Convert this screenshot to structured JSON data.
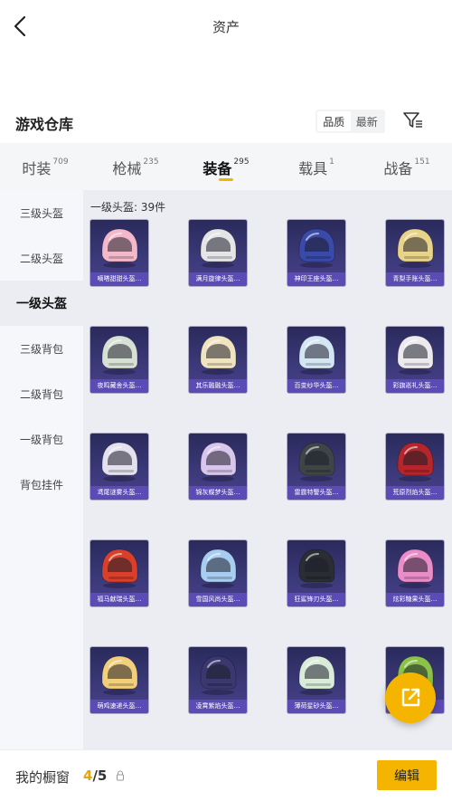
{
  "header": {
    "title": "资产"
  },
  "section": {
    "title": "游戏仓库",
    "sort_options": [
      "品质",
      "最新"
    ],
    "active_sort": 0
  },
  "tabs": [
    {
      "label": "时装",
      "count": "709"
    },
    {
      "label": "枪械",
      "count": "235"
    },
    {
      "label": "装备",
      "count": "295",
      "active": true
    },
    {
      "label": "载具",
      "count": "1"
    },
    {
      "label": "战备",
      "count": "151"
    }
  ],
  "sidebar": {
    "items": [
      {
        "label": "三级头盔"
      },
      {
        "label": "二级头盔"
      },
      {
        "label": "一级头盔",
        "active": true
      },
      {
        "label": "三级背包"
      },
      {
        "label": "二级背包"
      },
      {
        "label": "一级背包"
      },
      {
        "label": "背包挂件"
      }
    ]
  },
  "content": {
    "heading": "一级头盔: 39件",
    "items": [
      {
        "name": "嘀嗒甜甜头盔…",
        "color": "#f3b8c9"
      },
      {
        "name": "满月旋律头盔…",
        "color": "#e5e5e8"
      },
      {
        "name": "神印王座头盔…",
        "color": "#3a4aa8"
      },
      {
        "name": "青梨手账头盔…",
        "color": "#e7d389"
      },
      {
        "name": "夜鸣藏舍头盔…",
        "color": "#d7e0d4"
      },
      {
        "name": "其乐融融头盔…",
        "color": "#f0e3c2"
      },
      {
        "name": "百变纱华头盔…",
        "color": "#d4e5f4"
      },
      {
        "name": "彩旗巡礼头盔…",
        "color": "#eceaef"
      },
      {
        "name": "鸢尾谜雾头盔…",
        "color": "#e3e1ee"
      },
      {
        "name": "锦灰蝶梦头盔…",
        "color": "#d9c6ec"
      },
      {
        "name": "雷霆特警头盔…",
        "color": "#3f4547"
      },
      {
        "name": "荒原烈焰头盔…",
        "color": "#b4262b"
      },
      {
        "name": "福马献瑞头盔…",
        "color": "#d8402c"
      },
      {
        "name": "雪国风尚头盔…",
        "color": "#a9cdf0"
      },
      {
        "name": "狂鲨锋刃头盔…",
        "color": "#2a2d33"
      },
      {
        "name": "炫彩糖果头盔…",
        "color": "#e98cc8"
      },
      {
        "name": "萌鸡速递头盔…",
        "color": "#f1cf7b"
      },
      {
        "name": "凌霄紫焰头盔…",
        "color": "#3b3870"
      },
      {
        "name": "薄荷星砂头盔…",
        "color": "#d8ecd9"
      },
      {
        "name": "",
        "color": "#8ac24a"
      }
    ]
  },
  "bottombar": {
    "label": "我的橱窗",
    "used": "4",
    "separator": "/",
    "total": "5",
    "edit_label": "编辑"
  },
  "colors": {
    "accent": "#f4b400",
    "card_bg": "#3c3a7a",
    "card_label": "#5a4bb5"
  }
}
